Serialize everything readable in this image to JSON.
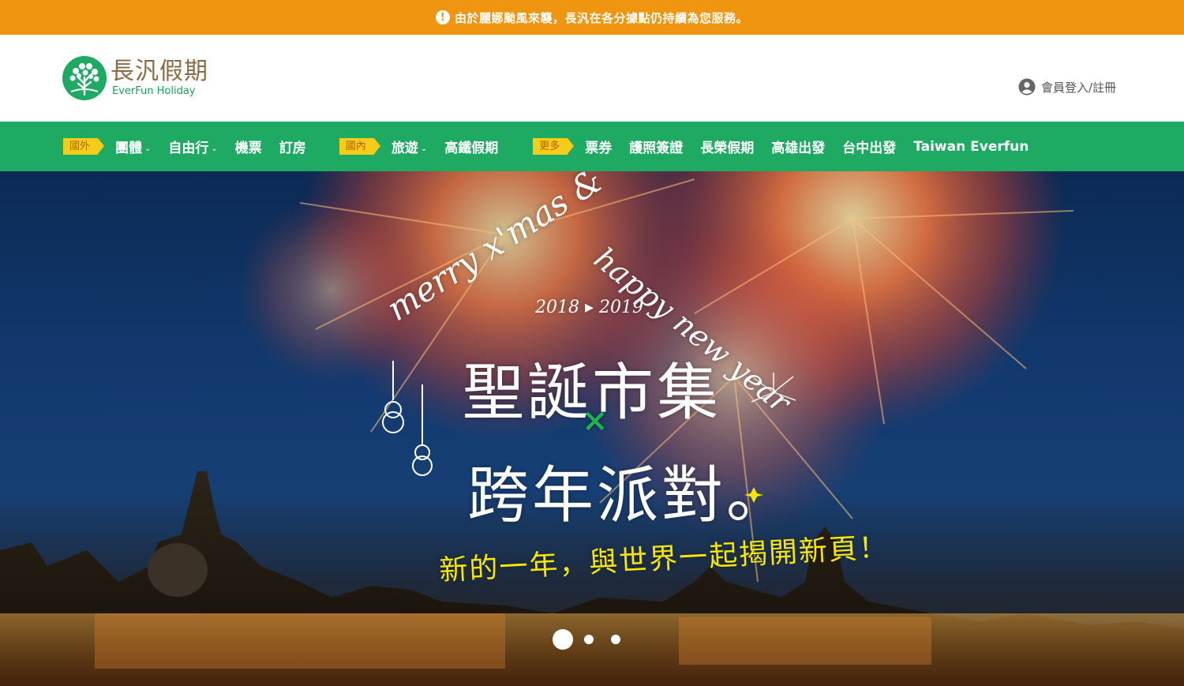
{
  "alert": {
    "icon": "exclamation-circle-icon",
    "text": "由於麗娜颱風來襲，長汎在各分據點仍持續為您服務。"
  },
  "header": {
    "logo_cn": "長汎假期",
    "logo_en": "EverFun Holiday",
    "login_label": "會員登入/註冊",
    "login_icon": "user-circle-icon"
  },
  "nav": {
    "groups": [
      {
        "tag": "國外",
        "items": [
          {
            "label": "團體",
            "dropdown": true
          },
          {
            "label": "自由行",
            "dropdown": true
          },
          {
            "label": "機票",
            "dropdown": false
          },
          {
            "label": "訂房",
            "dropdown": false
          }
        ]
      },
      {
        "tag": "國內",
        "items": [
          {
            "label": "旅遊",
            "dropdown": true
          },
          {
            "label": "高鐵假期",
            "dropdown": false
          }
        ]
      },
      {
        "tag": "更多",
        "items": [
          {
            "label": "票券",
            "dropdown": false
          },
          {
            "label": "護照簽證",
            "dropdown": false
          },
          {
            "label": "長榮假期",
            "dropdown": false
          },
          {
            "label": "高雄出發",
            "dropdown": false
          },
          {
            "label": "台中出發",
            "dropdown": false
          },
          {
            "label": "Taiwan Everfun",
            "dropdown": false
          }
        ]
      }
    ]
  },
  "hero": {
    "line_merry": "merry x'mas &",
    "line_happy": "happy new year",
    "years": "2018 ▸ 2019",
    "title_1": "聖誕市集",
    "title_cross": "×",
    "title_2": "跨年派對。",
    "tagline": "新的一年，與世界一起揭開新頁！",
    "slides_total": 3,
    "slide_active": 1
  },
  "colors": {
    "alert": "#f0950f",
    "brand_green": "#1faa64",
    "tag_yellow": "#f5cc19",
    "logo_brown": "#8a6a42",
    "tagline_yellow": "#f8e600"
  }
}
